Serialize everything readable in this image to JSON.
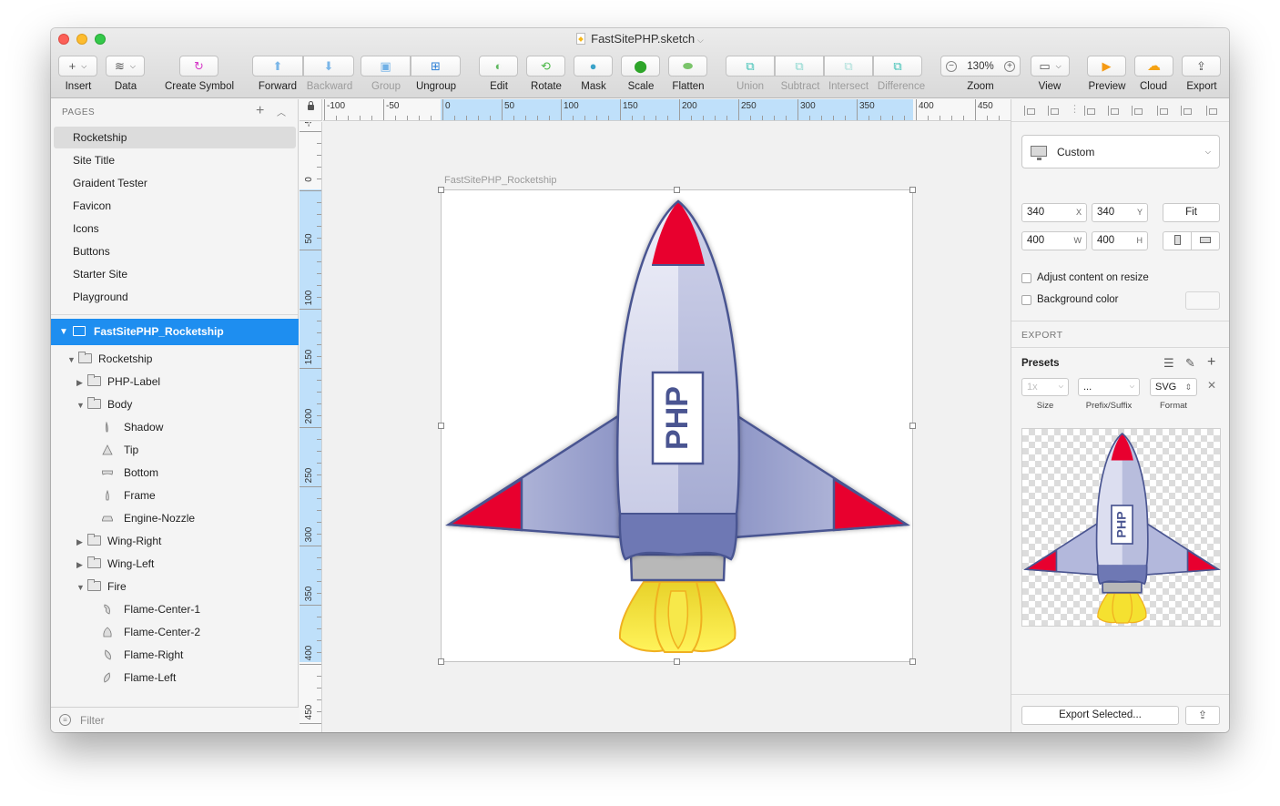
{
  "window": {
    "title": "FastSitePHP.sketch",
    "title_caret": "⌵"
  },
  "toolbar": {
    "insert": "Insert",
    "data": "Data",
    "create_symbol": "Create Symbol",
    "forward": "Forward",
    "backward": "Backward",
    "group": "Group",
    "ungroup": "Ungroup",
    "edit": "Edit",
    "rotate": "Rotate",
    "mask": "Mask",
    "scale": "Scale",
    "flatten": "Flatten",
    "union": "Union",
    "subtract": "Subtract",
    "intersect": "Intersect",
    "difference": "Difference",
    "zoom_label": "Zoom",
    "zoom_value": "130%",
    "view": "View",
    "preview": "Preview",
    "cloud": "Cloud",
    "export": "Export"
  },
  "pages": {
    "heading": "PAGES",
    "items": [
      "Rocketship",
      "Site Title",
      "Graident Tester",
      "Favicon",
      "Icons",
      "Buttons",
      "Starter Site",
      "Playground"
    ],
    "selected": "Rocketship"
  },
  "layers": {
    "artboard": "FastSitePHP_Rocketship",
    "rocketship": "Rocketship",
    "php_label": "PHP-Label",
    "body": "Body",
    "shadow": "Shadow",
    "tip": "Tip",
    "bottom": "Bottom",
    "frame": "Frame",
    "engine_nozzle": "Engine-Nozzle",
    "wing_right": "Wing-Right",
    "wing_left": "Wing-Left",
    "fire": "Fire",
    "flame_center_1": "Flame-Center-1",
    "flame_center_2": "Flame-Center-2",
    "flame_right": "Flame-Right",
    "flame_left": "Flame-Left",
    "filter_placeholder": "Filter"
  },
  "rulers": {
    "horizontal": [
      "-100",
      "-50",
      "0",
      "50",
      "100",
      "150",
      "200",
      "250",
      "300",
      "350",
      "400",
      "450"
    ],
    "vertical": [
      "-50",
      "0",
      "50",
      "100",
      "150",
      "200",
      "250",
      "300",
      "350",
      "400",
      "450"
    ]
  },
  "canvas": {
    "artboard_title": "FastSitePHP_Rocketship",
    "rocket_label": "PHP"
  },
  "inspector": {
    "preset": "Custom",
    "x": "340",
    "x_suffix": "X",
    "y": "340",
    "y_suffix": "Y",
    "w": "400",
    "w_suffix": "W",
    "h": "400",
    "h_suffix": "H",
    "fit": "Fit",
    "adjust_content": "Adjust content on resize",
    "background_color": "Background color",
    "export_heading": "EXPORT",
    "presets_heading": "Presets",
    "size_value": "1x",
    "prefix_value": "...",
    "format_value": "SVG",
    "size_label": "Size",
    "prefix_label": "Prefix/Suffix",
    "format_label": "Format",
    "export_selected": "Export Selected..."
  },
  "colors": {
    "selection_blue": "#1e8ef0",
    "ruler_highlight": "#bfe0fa",
    "rocket_red": "#e8002f",
    "rocket_body": "#d4d6ea",
    "rocket_shade": "#6e78b4",
    "flame_yellow": "#f5e130"
  }
}
